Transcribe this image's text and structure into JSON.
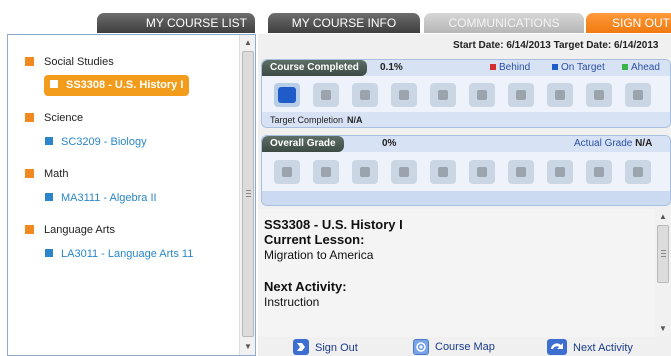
{
  "tabs": {
    "course_list": "My Course List",
    "course_info": "My Course Info",
    "communications": "Communications",
    "sign_out": "Sign Out"
  },
  "sidebar": {
    "groups": [
      {
        "subject": "Social Studies",
        "course": "SS3308 - U.S. History I",
        "selected": true
      },
      {
        "subject": "Science",
        "course": "SC3209 - Biology",
        "selected": false
      },
      {
        "subject": "Math",
        "course": "MA3111 - Algebra II",
        "selected": false
      },
      {
        "subject": "Language Arts",
        "course": "LA3011 - Language Arts 11",
        "selected": false
      }
    ]
  },
  "dates": {
    "text": "Start Date: 6/14/2013 Target Date: 6/14/2013"
  },
  "progress": {
    "title": "Course Completed",
    "value": "0.1%",
    "legend": {
      "behind": "Behind",
      "on_target": "On Target",
      "ahead": "Ahead"
    },
    "target_label": "Target Completion",
    "target_value": "N/A",
    "lessons_total": 10,
    "lessons_done": 1
  },
  "grade": {
    "title": "Overall Grade",
    "value": "0%",
    "actual_label": "Actual Grade",
    "actual_value": "N/A"
  },
  "lesson": {
    "course": "SS3308 - U.S. History I",
    "current_label": "Current Lesson:",
    "current_value": "Migration to America",
    "next_label": "Next Activity:",
    "next_value": "Instruction"
  },
  "actions": {
    "sign_out": "Sign Out",
    "course_map": "Course Map",
    "next_activity": "Next Activity"
  },
  "colors": {
    "accent_orange": "#f39c1b",
    "link_blue": "#2a86c8",
    "behind": "#d32f2f",
    "on_target": "#1f5bc9",
    "ahead": "#3bb54a"
  },
  "icons": {
    "sign_out": "sign-out-icon",
    "course_map": "course-map-icon",
    "next_activity": "next-activity-icon"
  }
}
